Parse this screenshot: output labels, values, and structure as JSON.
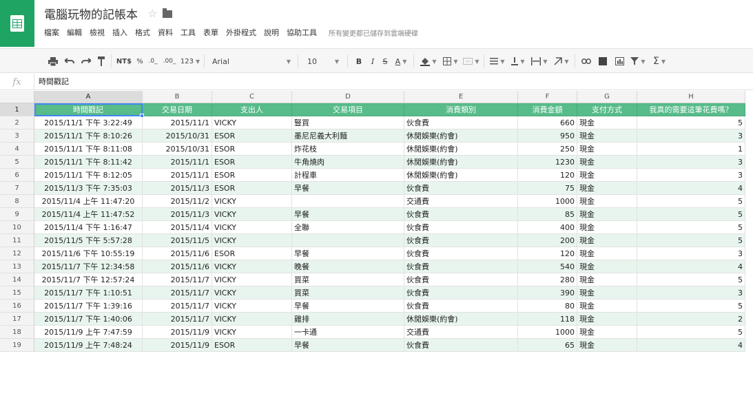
{
  "app": {
    "doc_title": "電腦玩物的記帳本",
    "menus": [
      "檔案",
      "編輯",
      "檢視",
      "插入",
      "格式",
      "資料",
      "工具",
      "表單",
      "外掛程式",
      "說明",
      "協助工具"
    ],
    "save_status": "所有變更都已儲存到雲端硬碟",
    "accent_color": "#1fa463",
    "header_color": "#57bb8a",
    "band_color": "#e8f5ee"
  },
  "toolbar": {
    "currency": "NT$",
    "percent": "%",
    "decimal_decrease": ".0_",
    "decimal_increase": ".00_",
    "more_formats": "123",
    "font": "Arial",
    "font_size": "10",
    "bold": "B",
    "italic": "I",
    "strike": "S",
    "text_color": "A",
    "icons": [
      "print-icon",
      "undo-icon",
      "redo-icon",
      "paint-format-icon",
      "fill-color-icon",
      "borders-icon",
      "merge-icon",
      "align-icon",
      "valign-icon",
      "wrap-icon",
      "rotate-icon",
      "link-icon",
      "comment-icon",
      "chart-icon",
      "filter-icon",
      "functions-icon"
    ],
    "functions_label": "Σ"
  },
  "formula": {
    "fx": "fx",
    "value": "時間戳記"
  },
  "columns": [
    "A",
    "B",
    "C",
    "D",
    "E",
    "F",
    "G",
    "H"
  ],
  "header_row": {
    "number": "1",
    "cells": [
      "時間戳記",
      "交易日期",
      "支出人",
      "交易項目",
      "消費類別",
      "消費金額",
      "支付方式",
      "我真的需要這筆花費嗎？"
    ]
  },
  "rows": [
    {
      "n": "2",
      "ts": "2015/11/1 下午 3:22:49",
      "date": "2015/11/1",
      "who": "VICKY",
      "item": "豎買",
      "cat": "伙食費",
      "amt": "660",
      "pay": "現金",
      "need": "5"
    },
    {
      "n": "3",
      "ts": "2015/11/1 下午 8:10:26",
      "date": "2015/10/31",
      "who": "ESOR",
      "item": "墨尼尼義大利麵",
      "cat": "休閒娛樂(約會)",
      "amt": "950",
      "pay": "現金",
      "need": "3"
    },
    {
      "n": "4",
      "ts": "2015/11/1 下午 8:11:08",
      "date": "2015/10/31",
      "who": "ESOR",
      "item": "炸花枝",
      "cat": "休閒娛樂(約會)",
      "amt": "250",
      "pay": "現金",
      "need": "1"
    },
    {
      "n": "5",
      "ts": "2015/11/1 下午 8:11:42",
      "date": "2015/11/1",
      "who": "ESOR",
      "item": "牛角燒肉",
      "cat": "休閒娛樂(約會)",
      "amt": "1230",
      "pay": "現金",
      "need": "3"
    },
    {
      "n": "6",
      "ts": "2015/11/1 下午 8:12:05",
      "date": "2015/11/1",
      "who": "ESOR",
      "item": "計程車",
      "cat": "休閒娛樂(約會)",
      "amt": "120",
      "pay": "現金",
      "need": "3"
    },
    {
      "n": "7",
      "ts": "2015/11/3 下午 7:35:03",
      "date": "2015/11/3",
      "who": "ESOR",
      "item": "早餐",
      "cat": "伙食費",
      "amt": "75",
      "pay": "現金",
      "need": "4"
    },
    {
      "n": "8",
      "ts": "2015/11/4 上午 11:47:20",
      "date": "2015/11/2",
      "who": "VICKY",
      "item": "",
      "cat": "交通費",
      "amt": "1000",
      "pay": "現金",
      "need": "5"
    },
    {
      "n": "9",
      "ts": "2015/11/4 上午 11:47:52",
      "date": "2015/11/3",
      "who": "VICKY",
      "item": "早餐",
      "cat": "伙食費",
      "amt": "85",
      "pay": "現金",
      "need": "5"
    },
    {
      "n": "10",
      "ts": "2015/11/4 下午 1:16:47",
      "date": "2015/11/4",
      "who": "VICKY",
      "item": "全聯",
      "cat": "伙食費",
      "amt": "400",
      "pay": "現金",
      "need": "5"
    },
    {
      "n": "11",
      "ts": "2015/11/5 下午 5:57:28",
      "date": "2015/11/5",
      "who": "VICKY",
      "item": "",
      "cat": "伙食費",
      "amt": "200",
      "pay": "現金",
      "need": "5"
    },
    {
      "n": "12",
      "ts": "2015/11/6 下午 10:55:19",
      "date": "2015/11/6",
      "who": "ESOR",
      "item": "早餐",
      "cat": "伙食費",
      "amt": "120",
      "pay": "現金",
      "need": "3"
    },
    {
      "n": "13",
      "ts": "2015/11/7 下午 12:34:58",
      "date": "2015/11/6",
      "who": "VICKY",
      "item": "晚餐",
      "cat": "伙食費",
      "amt": "540",
      "pay": "現金",
      "need": "4"
    },
    {
      "n": "14",
      "ts": "2015/11/7 下午 12:57:24",
      "date": "2015/11/7",
      "who": "VICKY",
      "item": "買菜",
      "cat": "伙食費",
      "amt": "280",
      "pay": "現金",
      "need": "5"
    },
    {
      "n": "15",
      "ts": "2015/11/7 下午 1:10:51",
      "date": "2015/11/7",
      "who": "VICKY",
      "item": "買菜",
      "cat": "伙食費",
      "amt": "390",
      "pay": "現金",
      "need": "3"
    },
    {
      "n": "16",
      "ts": "2015/11/7 下午 1:39:16",
      "date": "2015/11/7",
      "who": "VICKY",
      "item": "早餐",
      "cat": "伙食費",
      "amt": "80",
      "pay": "現金",
      "need": "5"
    },
    {
      "n": "17",
      "ts": "2015/11/7 下午 1:40:06",
      "date": "2015/11/7",
      "who": "VICKY",
      "item": "雞排",
      "cat": "休閒娛樂(約會)",
      "amt": "118",
      "pay": "現金",
      "need": "2"
    },
    {
      "n": "18",
      "ts": "2015/11/9 上午 7:47:59",
      "date": "2015/11/9",
      "who": "VICKY",
      "item": "一卡通",
      "cat": "交通費",
      "amt": "1000",
      "pay": "現金",
      "need": "5"
    },
    {
      "n": "19",
      "ts": "2015/11/9 上午 7:48:24",
      "date": "2015/11/9",
      "who": "ESOR",
      "item": "早餐",
      "cat": "伙食費",
      "amt": "65",
      "pay": "現金",
      "need": "4"
    }
  ]
}
